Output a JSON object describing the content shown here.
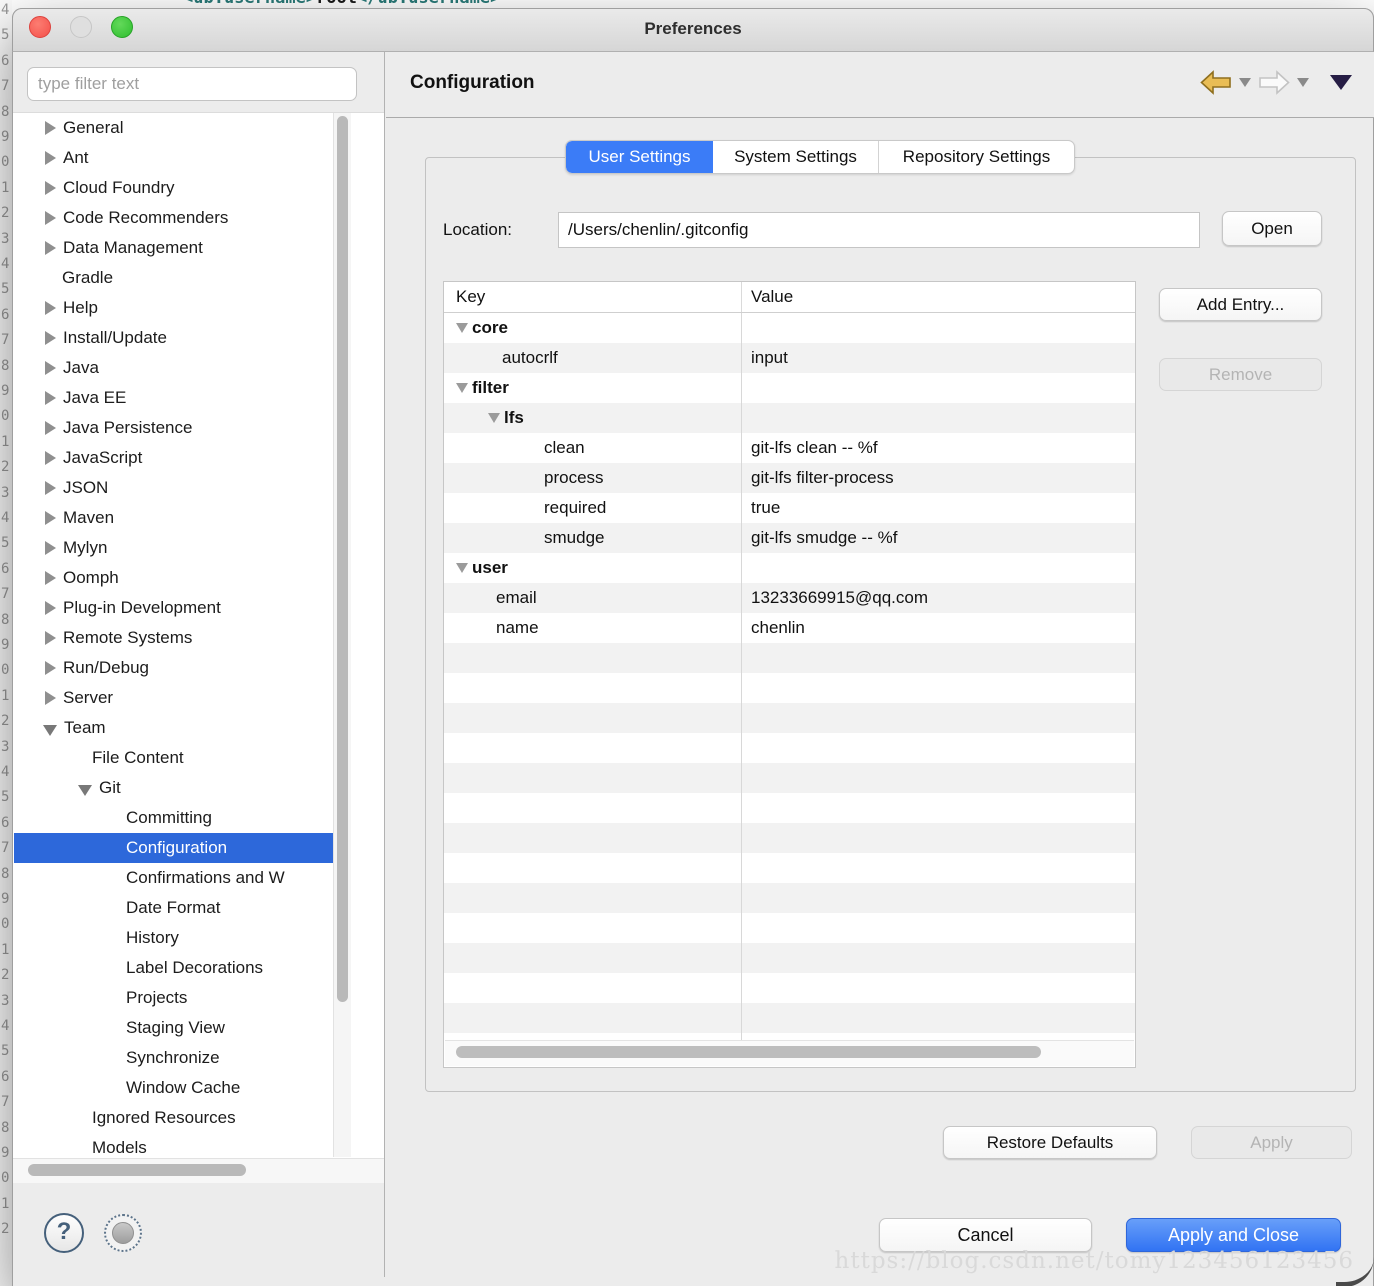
{
  "background": {
    "code_tag_open": "<ub.username>",
    "code_value": "root",
    "code_tag_close": "</ub.username>",
    "gutter_digits": "4567890123456789012345678901234567890123456789012"
  },
  "window": {
    "title": "Preferences"
  },
  "sidebar": {
    "filter_placeholder": "type filter text",
    "items": [
      {
        "label": "General",
        "pad": 31,
        "arrow": "c"
      },
      {
        "label": "Ant",
        "pad": 31,
        "arrow": "c"
      },
      {
        "label": "Cloud Foundry",
        "pad": 31,
        "arrow": "c"
      },
      {
        "label": "Code Recommenders",
        "pad": 31,
        "arrow": "c"
      },
      {
        "label": "Data Management",
        "pad": 31,
        "arrow": "c"
      },
      {
        "label": "Gradle",
        "pad": 48,
        "arrow": null
      },
      {
        "label": "Help",
        "pad": 31,
        "arrow": "c"
      },
      {
        "label": "Install/Update",
        "pad": 31,
        "arrow": "c"
      },
      {
        "label": "Java",
        "pad": 31,
        "arrow": "c"
      },
      {
        "label": "Java EE",
        "pad": 31,
        "arrow": "c"
      },
      {
        "label": "Java Persistence",
        "pad": 31,
        "arrow": "c"
      },
      {
        "label": "JavaScript",
        "pad": 31,
        "arrow": "c"
      },
      {
        "label": "JSON",
        "pad": 31,
        "arrow": "c"
      },
      {
        "label": "Maven",
        "pad": 31,
        "arrow": "c"
      },
      {
        "label": "Mylyn",
        "pad": 31,
        "arrow": "c"
      },
      {
        "label": "Oomph",
        "pad": 31,
        "arrow": "c"
      },
      {
        "label": "Plug-in Development",
        "pad": 31,
        "arrow": "c"
      },
      {
        "label": "Remote Systems",
        "pad": 31,
        "arrow": "c"
      },
      {
        "label": "Run/Debug",
        "pad": 31,
        "arrow": "c"
      },
      {
        "label": "Server",
        "pad": 31,
        "arrow": "c"
      },
      {
        "label": "Team",
        "pad": 29,
        "arrow": "e"
      },
      {
        "label": "File Content",
        "pad": 78,
        "arrow": null
      },
      {
        "label": "Git",
        "pad": 64,
        "arrow": "e"
      },
      {
        "label": "Committing",
        "pad": 112,
        "arrow": null
      },
      {
        "label": "Configuration",
        "pad": 112,
        "arrow": null,
        "selected": true
      },
      {
        "label": "Confirmations and W",
        "pad": 112,
        "arrow": null
      },
      {
        "label": "Date Format",
        "pad": 112,
        "arrow": null
      },
      {
        "label": "History",
        "pad": 112,
        "arrow": null
      },
      {
        "label": "Label Decorations",
        "pad": 112,
        "arrow": null
      },
      {
        "label": "Projects",
        "pad": 112,
        "arrow": null
      },
      {
        "label": "Staging View",
        "pad": 112,
        "arrow": null
      },
      {
        "label": "Synchronize",
        "pad": 112,
        "arrow": null
      },
      {
        "label": "Window Cache",
        "pad": 112,
        "arrow": null
      },
      {
        "label": "Ignored Resources",
        "pad": 78,
        "arrow": null
      },
      {
        "label": "Models",
        "pad": 78,
        "arrow": null
      }
    ]
  },
  "header": {
    "title": "Configuration",
    "icons": [
      "back-arrow-icon",
      "back-history-caret-icon",
      "forward-arrow-icon",
      "forward-history-caret-icon",
      "view-menu-icon"
    ]
  },
  "tabs": {
    "items": [
      {
        "label": "User Settings",
        "active": true
      },
      {
        "label": "System Settings",
        "active": false
      },
      {
        "label": "Repository Settings",
        "active": false
      }
    ]
  },
  "location": {
    "label": "Location:",
    "value": "/Users/chenlin/.gitconfig",
    "open_label": "Open"
  },
  "table": {
    "columns": [
      "Key",
      "Value"
    ],
    "rows": [
      {
        "key": "core",
        "value": "",
        "bold": true,
        "tri": 12,
        "pad": 28
      },
      {
        "key": "autocrlf",
        "value": "input",
        "pad": 58
      },
      {
        "key": "filter",
        "value": "",
        "bold": true,
        "tri": 12,
        "pad": 28
      },
      {
        "key": "lfs",
        "value": "",
        "bold": true,
        "tri": 44,
        "pad": 60
      },
      {
        "key": "clean",
        "value": "git-lfs clean -- %f",
        "pad": 100
      },
      {
        "key": "process",
        "value": "git-lfs filter-process",
        "pad": 100
      },
      {
        "key": "required",
        "value": "true",
        "pad": 100
      },
      {
        "key": "smudge",
        "value": "git-lfs smudge -- %f",
        "pad": 100
      },
      {
        "key": "user",
        "value": "",
        "bold": true,
        "tri": 12,
        "pad": 28
      },
      {
        "key": "email",
        "value": "13233669915@qq.com",
        "pad": 52
      },
      {
        "key": "name",
        "value": "chenlin",
        "pad": 52
      }
    ],
    "empty_rows": 14
  },
  "actions": {
    "add_entry": "Add Entry...",
    "remove": "Remove",
    "restore_defaults": "Restore Defaults",
    "apply": "Apply",
    "cancel": "Cancel",
    "apply_and_close": "Apply and Close"
  },
  "watermark": "https://blog.csdn.net/tomy123456123456",
  "colors": {
    "tab_active_blue": "#3b7cf7",
    "sidebar_selection_blue": "#2d68da",
    "primary_button_blue": "#3173f3",
    "traffic_red": "#f4504a",
    "traffic_gray": "#dfdfdf",
    "traffic_green": "#2fbe2f",
    "back_arrow_gold": "#e9bd55"
  }
}
